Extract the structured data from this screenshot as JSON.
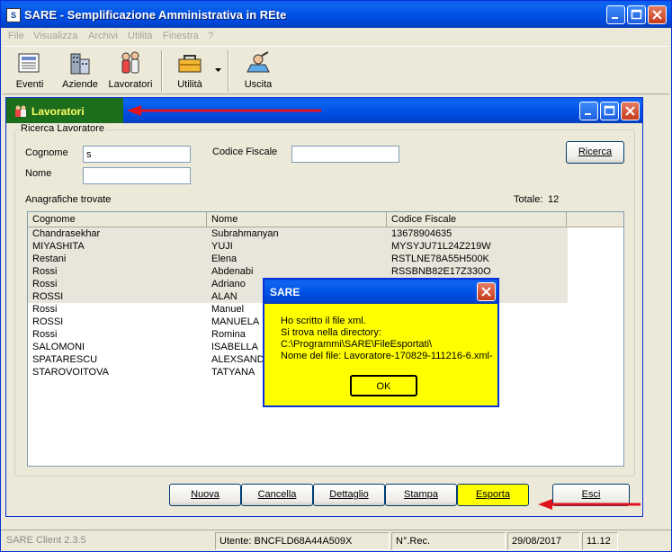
{
  "app": {
    "title": "SARE - Semplificazione Amministrativa in REte"
  },
  "menu": [
    "File",
    "Visualizza",
    "Archivi",
    "Utilità",
    "Finestra",
    "?"
  ],
  "toolbar": {
    "eventi": "Eventi",
    "aziende": "Aziende",
    "lavoratori": "Lavoratori",
    "utilita": "Utilità",
    "uscita": "Uscita"
  },
  "child": {
    "title": "Lavoratori",
    "group_label": "Ricerca Lavoratore",
    "cognome_label": "Cognome",
    "cognome_value": "s",
    "nome_label": "Nome",
    "nome_value": "",
    "cf_label": "Codice Fiscale",
    "cf_value": "",
    "ricerca_button": "Ricerca",
    "found_label": "Anagrafiche trovate",
    "total_label": "Totale:",
    "total_value": "12"
  },
  "grid": {
    "columns": [
      "Cognome",
      "Nome",
      "Codice Fiscale"
    ],
    "rows": [
      [
        "Chandrasekhar",
        "Subrahmanyan",
        "13678904635"
      ],
      [
        "MIYASHITA",
        "YUJI",
        "MYSYJU71L24Z219W"
      ],
      [
        "Restani",
        "Elena",
        "RSTLNE78A55H500K"
      ],
      [
        "Rossi",
        "Abdenabi",
        "RSSBNB82E17Z330O"
      ],
      [
        "Rossi",
        "Adriano",
        ""
      ],
      [
        "ROSSI",
        "ALAN",
        ""
      ],
      [
        "Rossi",
        "Manuel",
        ""
      ],
      [
        "ROSSI",
        "MANUELA",
        ""
      ],
      [
        "Rossi",
        "Romina",
        ""
      ],
      [
        "SALOMONI",
        "ISABELLA",
        ""
      ],
      [
        "SPATARESCU",
        "ALEXSAND",
        ""
      ],
      [
        "STAROVOITOVA",
        "TATYANA",
        ""
      ]
    ]
  },
  "buttons": {
    "nuova": "Nuova",
    "cancella": "Cancella",
    "dettaglio": "Dettaglio",
    "stampa": "Stampa",
    "esporta": "Esporta",
    "esci": "Esci"
  },
  "dialog": {
    "title": "SARE",
    "line1": "Ho scritto il file xml.",
    "line2": "Si trova nella directory:",
    "line3": "C:\\Programmi\\SARE\\FileEsportati\\",
    "line4": "Nome del file: Lavoratore-170829-111216-6.xml-",
    "ok": "OK"
  },
  "status": {
    "client": "SARE Client 2.3.5",
    "utente": "Utente: BNCFLD68A44A509X",
    "nrec": "N°.Rec.",
    "date": "29/08/2017",
    "time": "11.12"
  },
  "colors": {
    "titlebar": "#0052E6",
    "highlight": "#1C6E1C",
    "dialog_bg": "#FFFF00",
    "arrow": "#E0141E"
  }
}
